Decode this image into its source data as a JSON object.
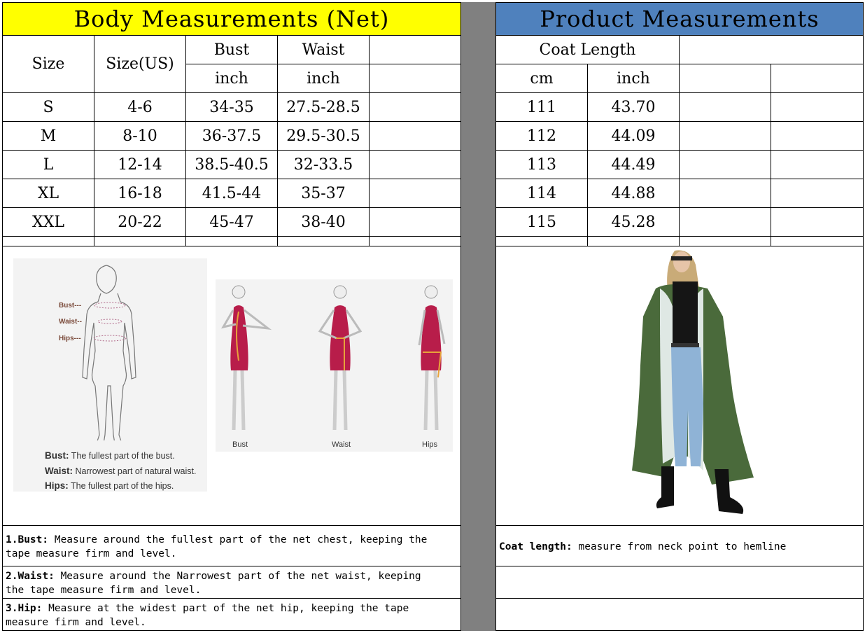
{
  "left_title": "Body Measurements (Net)",
  "right_title": "Product Measurements",
  "colors": {
    "left_header_bg": "#ffff00",
    "right_header_bg": "#4f81bd",
    "divider": "#808080",
    "dress": "#b81d4a",
    "coat": "#4a6a3b"
  },
  "left_table": {
    "col_size": "Size",
    "col_size_us": "Size(US)",
    "col_bust": "Bust",
    "col_waist": "Waist",
    "unit": "inch",
    "rows": [
      [
        "S",
        "4-6",
        "34-35",
        "27.5-28.5"
      ],
      [
        "M",
        "8-10",
        "36-37.5",
        "29.5-30.5"
      ],
      [
        "L",
        "12-14",
        "38.5-40.5",
        "32-33.5"
      ],
      [
        "XL",
        "16-18",
        "41.5-44",
        "35-37"
      ],
      [
        "XXL",
        "20-22",
        "45-47",
        "38-40"
      ]
    ]
  },
  "right_table": {
    "col_coat_length": "Coat Length",
    "unit_cm": "cm",
    "unit_inch": "inch",
    "rows": [
      [
        "111",
        "43.70"
      ],
      [
        "112",
        "44.09"
      ],
      [
        "113",
        "44.49"
      ],
      [
        "114",
        "44.88"
      ],
      [
        "115",
        "45.28"
      ]
    ]
  },
  "figure_body": {
    "labels": [
      "Bust---",
      "Waist--",
      "Hips---"
    ],
    "legend": [
      {
        "term": "Bust:",
        "desc": "The fullest part of the bust."
      },
      {
        "term": "Waist:",
        "desc": "Narrowest part of natural waist."
      },
      {
        "term": "Hips:",
        "desc": "The fullest part of the hips."
      }
    ]
  },
  "figure_dress": {
    "captions": [
      "Bust",
      "Waist",
      "Hips"
    ]
  },
  "notes": [
    {
      "term": "1.Bust:",
      "line1": " Measure around the fullest part of the net chest, keeping the",
      "line2": "tape  measure firm and level."
    },
    {
      "term": "2.Waist:",
      "line1": " Measure around the Narrowest part of the net waist, keeping",
      "line2": "the tape  measure firm and level."
    },
    {
      "term": "3.Hip:",
      "line1": " Measure at the widest part of the net hip, keeping the tape",
      "line2": "measure firm and level."
    }
  ],
  "coat_note": {
    "term": "Coat length:",
    "desc": " measure from neck point to hemline"
  }
}
